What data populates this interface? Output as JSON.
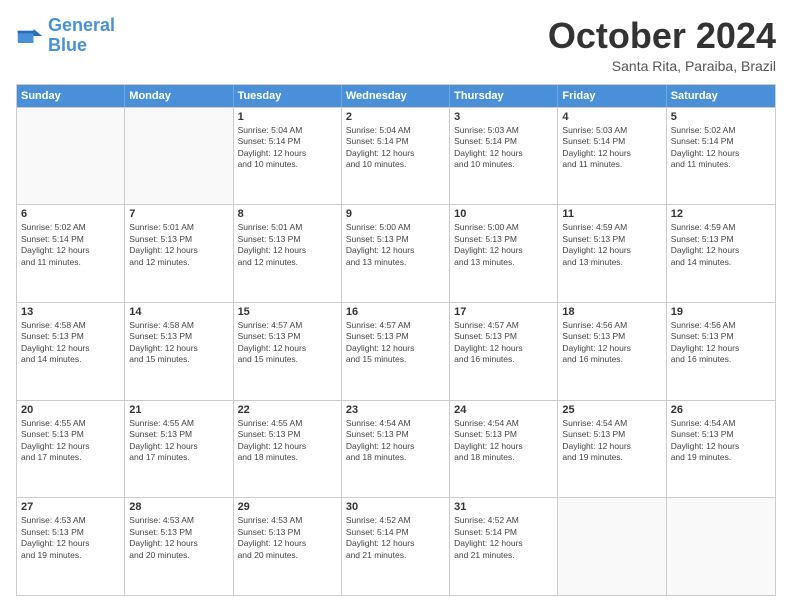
{
  "logo": {
    "line1": "General",
    "line2": "Blue"
  },
  "title": "October 2024",
  "location": "Santa Rita, Paraiba, Brazil",
  "days_header": [
    "Sunday",
    "Monday",
    "Tuesday",
    "Wednesday",
    "Thursday",
    "Friday",
    "Saturday"
  ],
  "weeks": [
    [
      {
        "day": "",
        "info": ""
      },
      {
        "day": "",
        "info": ""
      },
      {
        "day": "1",
        "info": "Sunrise: 5:04 AM\nSunset: 5:14 PM\nDaylight: 12 hours\nand 10 minutes."
      },
      {
        "day": "2",
        "info": "Sunrise: 5:04 AM\nSunset: 5:14 PM\nDaylight: 12 hours\nand 10 minutes."
      },
      {
        "day": "3",
        "info": "Sunrise: 5:03 AM\nSunset: 5:14 PM\nDaylight: 12 hours\nand 10 minutes."
      },
      {
        "day": "4",
        "info": "Sunrise: 5:03 AM\nSunset: 5:14 PM\nDaylight: 12 hours\nand 11 minutes."
      },
      {
        "day": "5",
        "info": "Sunrise: 5:02 AM\nSunset: 5:14 PM\nDaylight: 12 hours\nand 11 minutes."
      }
    ],
    [
      {
        "day": "6",
        "info": "Sunrise: 5:02 AM\nSunset: 5:14 PM\nDaylight: 12 hours\nand 11 minutes."
      },
      {
        "day": "7",
        "info": "Sunrise: 5:01 AM\nSunset: 5:13 PM\nDaylight: 12 hours\nand 12 minutes."
      },
      {
        "day": "8",
        "info": "Sunrise: 5:01 AM\nSunset: 5:13 PM\nDaylight: 12 hours\nand 12 minutes."
      },
      {
        "day": "9",
        "info": "Sunrise: 5:00 AM\nSunset: 5:13 PM\nDaylight: 12 hours\nand 13 minutes."
      },
      {
        "day": "10",
        "info": "Sunrise: 5:00 AM\nSunset: 5:13 PM\nDaylight: 12 hours\nand 13 minutes."
      },
      {
        "day": "11",
        "info": "Sunrise: 4:59 AM\nSunset: 5:13 PM\nDaylight: 12 hours\nand 13 minutes."
      },
      {
        "day": "12",
        "info": "Sunrise: 4:59 AM\nSunset: 5:13 PM\nDaylight: 12 hours\nand 14 minutes."
      }
    ],
    [
      {
        "day": "13",
        "info": "Sunrise: 4:58 AM\nSunset: 5:13 PM\nDaylight: 12 hours\nand 14 minutes."
      },
      {
        "day": "14",
        "info": "Sunrise: 4:58 AM\nSunset: 5:13 PM\nDaylight: 12 hours\nand 15 minutes."
      },
      {
        "day": "15",
        "info": "Sunrise: 4:57 AM\nSunset: 5:13 PM\nDaylight: 12 hours\nand 15 minutes."
      },
      {
        "day": "16",
        "info": "Sunrise: 4:57 AM\nSunset: 5:13 PM\nDaylight: 12 hours\nand 15 minutes."
      },
      {
        "day": "17",
        "info": "Sunrise: 4:57 AM\nSunset: 5:13 PM\nDaylight: 12 hours\nand 16 minutes."
      },
      {
        "day": "18",
        "info": "Sunrise: 4:56 AM\nSunset: 5:13 PM\nDaylight: 12 hours\nand 16 minutes."
      },
      {
        "day": "19",
        "info": "Sunrise: 4:56 AM\nSunset: 5:13 PM\nDaylight: 12 hours\nand 16 minutes."
      }
    ],
    [
      {
        "day": "20",
        "info": "Sunrise: 4:55 AM\nSunset: 5:13 PM\nDaylight: 12 hours\nand 17 minutes."
      },
      {
        "day": "21",
        "info": "Sunrise: 4:55 AM\nSunset: 5:13 PM\nDaylight: 12 hours\nand 17 minutes."
      },
      {
        "day": "22",
        "info": "Sunrise: 4:55 AM\nSunset: 5:13 PM\nDaylight: 12 hours\nand 18 minutes."
      },
      {
        "day": "23",
        "info": "Sunrise: 4:54 AM\nSunset: 5:13 PM\nDaylight: 12 hours\nand 18 minutes."
      },
      {
        "day": "24",
        "info": "Sunrise: 4:54 AM\nSunset: 5:13 PM\nDaylight: 12 hours\nand 18 minutes."
      },
      {
        "day": "25",
        "info": "Sunrise: 4:54 AM\nSunset: 5:13 PM\nDaylight: 12 hours\nand 19 minutes."
      },
      {
        "day": "26",
        "info": "Sunrise: 4:54 AM\nSunset: 5:13 PM\nDaylight: 12 hours\nand 19 minutes."
      }
    ],
    [
      {
        "day": "27",
        "info": "Sunrise: 4:53 AM\nSunset: 5:13 PM\nDaylight: 12 hours\nand 19 minutes."
      },
      {
        "day": "28",
        "info": "Sunrise: 4:53 AM\nSunset: 5:13 PM\nDaylight: 12 hours\nand 20 minutes."
      },
      {
        "day": "29",
        "info": "Sunrise: 4:53 AM\nSunset: 5:13 PM\nDaylight: 12 hours\nand 20 minutes."
      },
      {
        "day": "30",
        "info": "Sunrise: 4:52 AM\nSunset: 5:14 PM\nDaylight: 12 hours\nand 21 minutes."
      },
      {
        "day": "31",
        "info": "Sunrise: 4:52 AM\nSunset: 5:14 PM\nDaylight: 12 hours\nand 21 minutes."
      },
      {
        "day": "",
        "info": ""
      },
      {
        "day": "",
        "info": ""
      }
    ]
  ]
}
